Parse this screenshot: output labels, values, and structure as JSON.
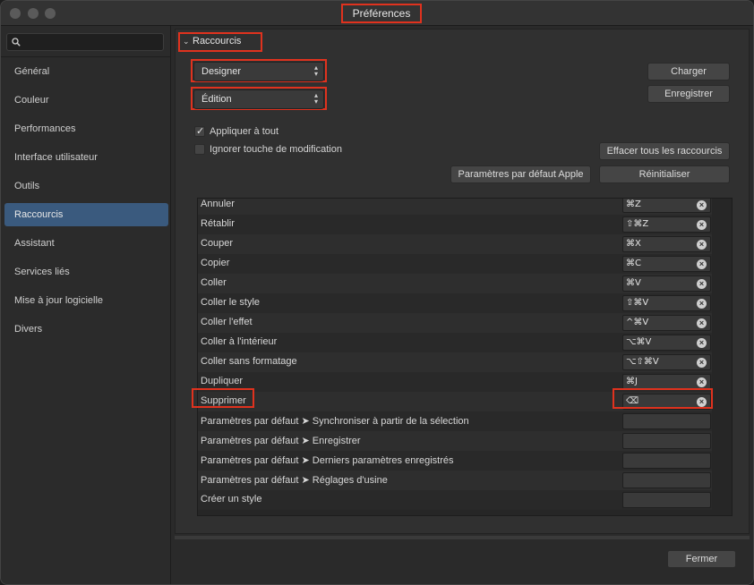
{
  "window": {
    "title": "Préférences"
  },
  "sidebar": {
    "search_placeholder": "",
    "items": [
      {
        "label": "Général"
      },
      {
        "label": "Couleur"
      },
      {
        "label": "Performances"
      },
      {
        "label": "Interface utilisateur"
      },
      {
        "label": "Outils"
      },
      {
        "label": "Raccourcis",
        "active": true
      },
      {
        "label": "Assistant"
      },
      {
        "label": "Services liés"
      },
      {
        "label": "Mise à jour logicielle"
      },
      {
        "label": "Divers"
      }
    ]
  },
  "shortcuts": {
    "section_title": "Raccourcis",
    "app_select": "Designer",
    "category_select": "Édition",
    "buttons": {
      "load": "Charger",
      "save": "Enregistrer",
      "clear_all": "Effacer tous les raccourcis",
      "apple_defaults": "Paramètres par défaut Apple",
      "reset": "Réinitialiser"
    },
    "options": {
      "apply_all": {
        "label": "Appliquer à tout",
        "checked": true
      },
      "ignore_modifier": {
        "label": "Ignorer touche de modification",
        "checked": false
      }
    },
    "rows": [
      {
        "name": "Annuler",
        "key": "⌘Z"
      },
      {
        "name": "Rétablir",
        "key": "⇧⌘Z"
      },
      {
        "name": "Couper",
        "key": "⌘X"
      },
      {
        "name": "Copier",
        "key": "⌘C"
      },
      {
        "name": "Coller",
        "key": "⌘V"
      },
      {
        "name": "Coller le style",
        "key": "⇧⌘V"
      },
      {
        "name": "Coller l'effet",
        "key": "^⌘V"
      },
      {
        "name": "Coller à l'intérieur",
        "key": "⌥⌘V"
      },
      {
        "name": "Coller sans formatage",
        "key": "⌥⇧⌘V"
      },
      {
        "name": "Dupliquer",
        "key": "⌘J"
      },
      {
        "name": "Supprimer",
        "key": "⌫"
      },
      {
        "name": "Paramètres par défaut ➤ Synchroniser à partir de la sélection",
        "key": ""
      },
      {
        "name": "Paramètres par défaut ➤ Enregistrer",
        "key": ""
      },
      {
        "name": "Paramètres par défaut ➤ Derniers paramètres enregistrés",
        "key": ""
      },
      {
        "name": "Paramètres par défaut ➤ Réglages d'usine",
        "key": ""
      },
      {
        "name": "Créer un style",
        "key": ""
      }
    ]
  },
  "footer": {
    "close_label": "Fermer"
  }
}
